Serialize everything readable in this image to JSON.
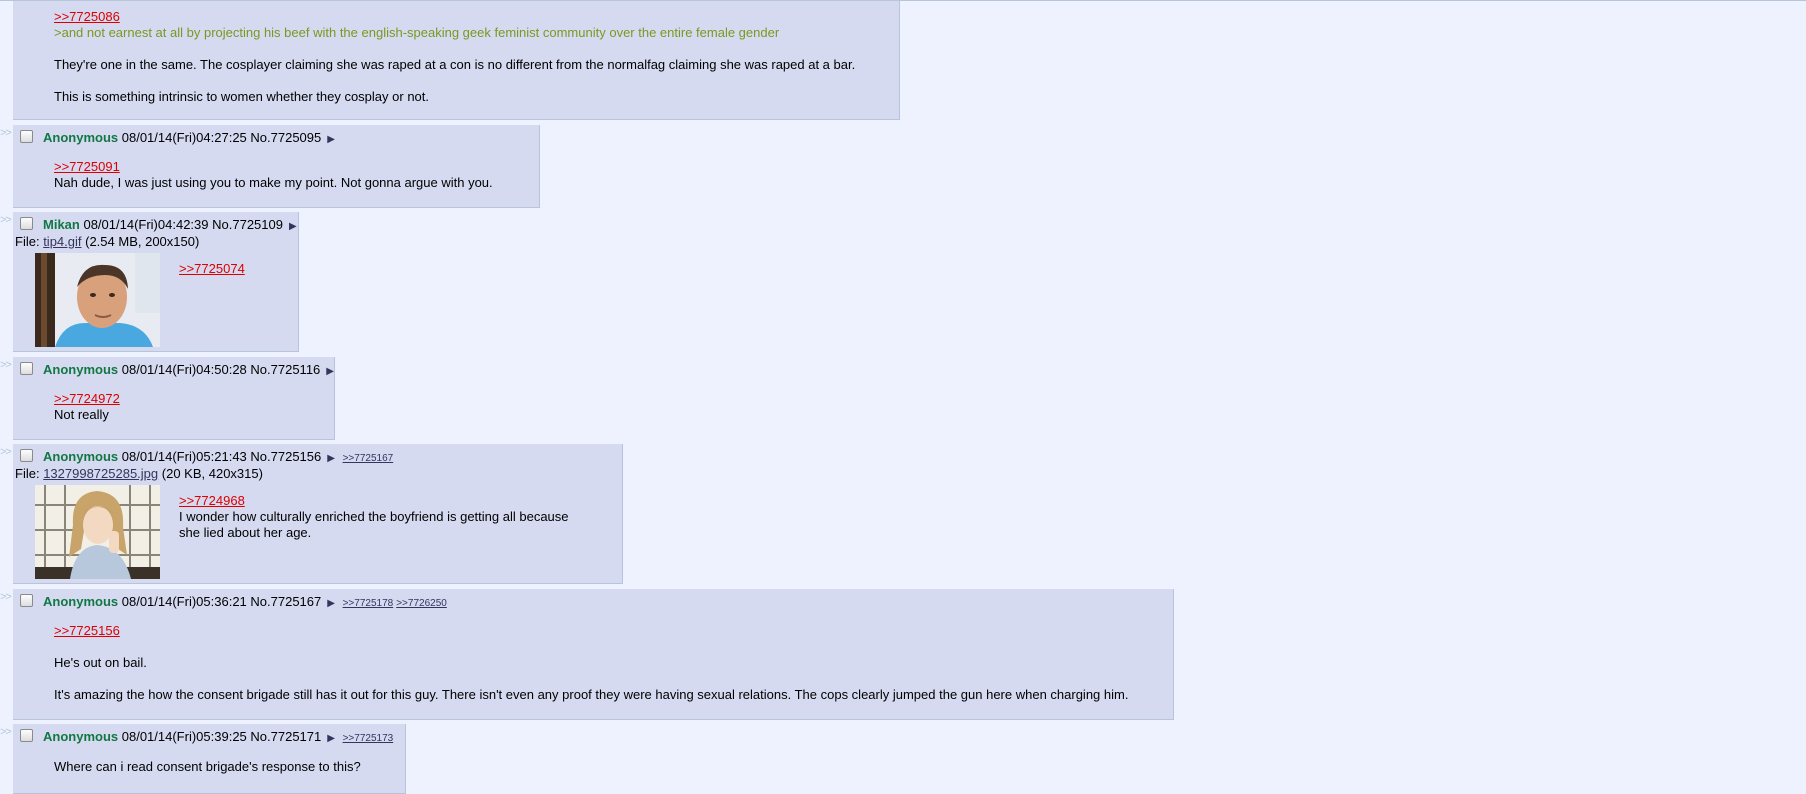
{
  "posts": [
    {
      "message": {
        "quote": ">>7725086",
        "greentext": ">and not earnest at all by projecting his beef with the english-speaking geek feminist community over the entire female gender",
        "line1": "They're one in the same. The cosplayer claiming she was raped at a con is no different from the normalfag claiming she was raped at a bar.",
        "line2": "This is something intrinsic to women whether they cosplay or not."
      }
    },
    {
      "arrows": ">>",
      "name": "Anonymous",
      "datetime": "08/01/14(Fri)04:27:25",
      "postno": "No.7725095",
      "menu": "▶",
      "message": {
        "quote": ">>7725091",
        "line1": "Nah dude, I was just using you to make my point. Not gonna argue with you."
      }
    },
    {
      "arrows": ">>",
      "name": "Mikan",
      "datetime": "08/01/14(Fri)04:42:39",
      "postno": "No.7725109",
      "menu": "▶",
      "file": {
        "label": "File:",
        "filename": "tip4.gif",
        "meta": "(2.54 MB, 200x150)"
      },
      "message": {
        "quote": ">>7725074"
      }
    },
    {
      "arrows": ">>",
      "name": "Anonymous",
      "datetime": "08/01/14(Fri)04:50:28",
      "postno": "No.7725116",
      "menu": "▶",
      "message": {
        "quote": ">>7724972",
        "line1": "Not really"
      }
    },
    {
      "arrows": ">>",
      "name": "Anonymous",
      "datetime": "08/01/14(Fri)05:21:43",
      "postno": "No.7725156",
      "menu": "▶",
      "backlinks": [
        ">>7725167"
      ],
      "file": {
        "label": "File:",
        "filename": "1327998725285.jpg",
        "meta": "(20 KB, 420x315)"
      },
      "message": {
        "quote": ">>7724968",
        "line1": "I wonder how culturally enriched the boyfriend is getting all because",
        "line2": "she lied about her age."
      }
    },
    {
      "arrows": ">>",
      "name": "Anonymous",
      "datetime": "08/01/14(Fri)05:36:21",
      "postno": "No.7725167",
      "menu": "▶",
      "backlinks": [
        ">>7725178",
        ">>7726250"
      ],
      "message": {
        "quote": ">>7725156",
        "line1": "He's out on bail.",
        "line2": "It's amazing the how the consent brigade still has it out for this guy. There isn't even any proof they were having sexual relations. The cops clearly jumped the gun here when charging him."
      }
    },
    {
      "arrows": ">>",
      "name": "Anonymous",
      "datetime": "08/01/14(Fri)05:39:25",
      "postno": "No.7725171",
      "menu": "▶",
      "backlinks": [
        ">>7725173"
      ],
      "message": {
        "line1": "Where can i read consent brigade's response to this?"
      }
    }
  ]
}
